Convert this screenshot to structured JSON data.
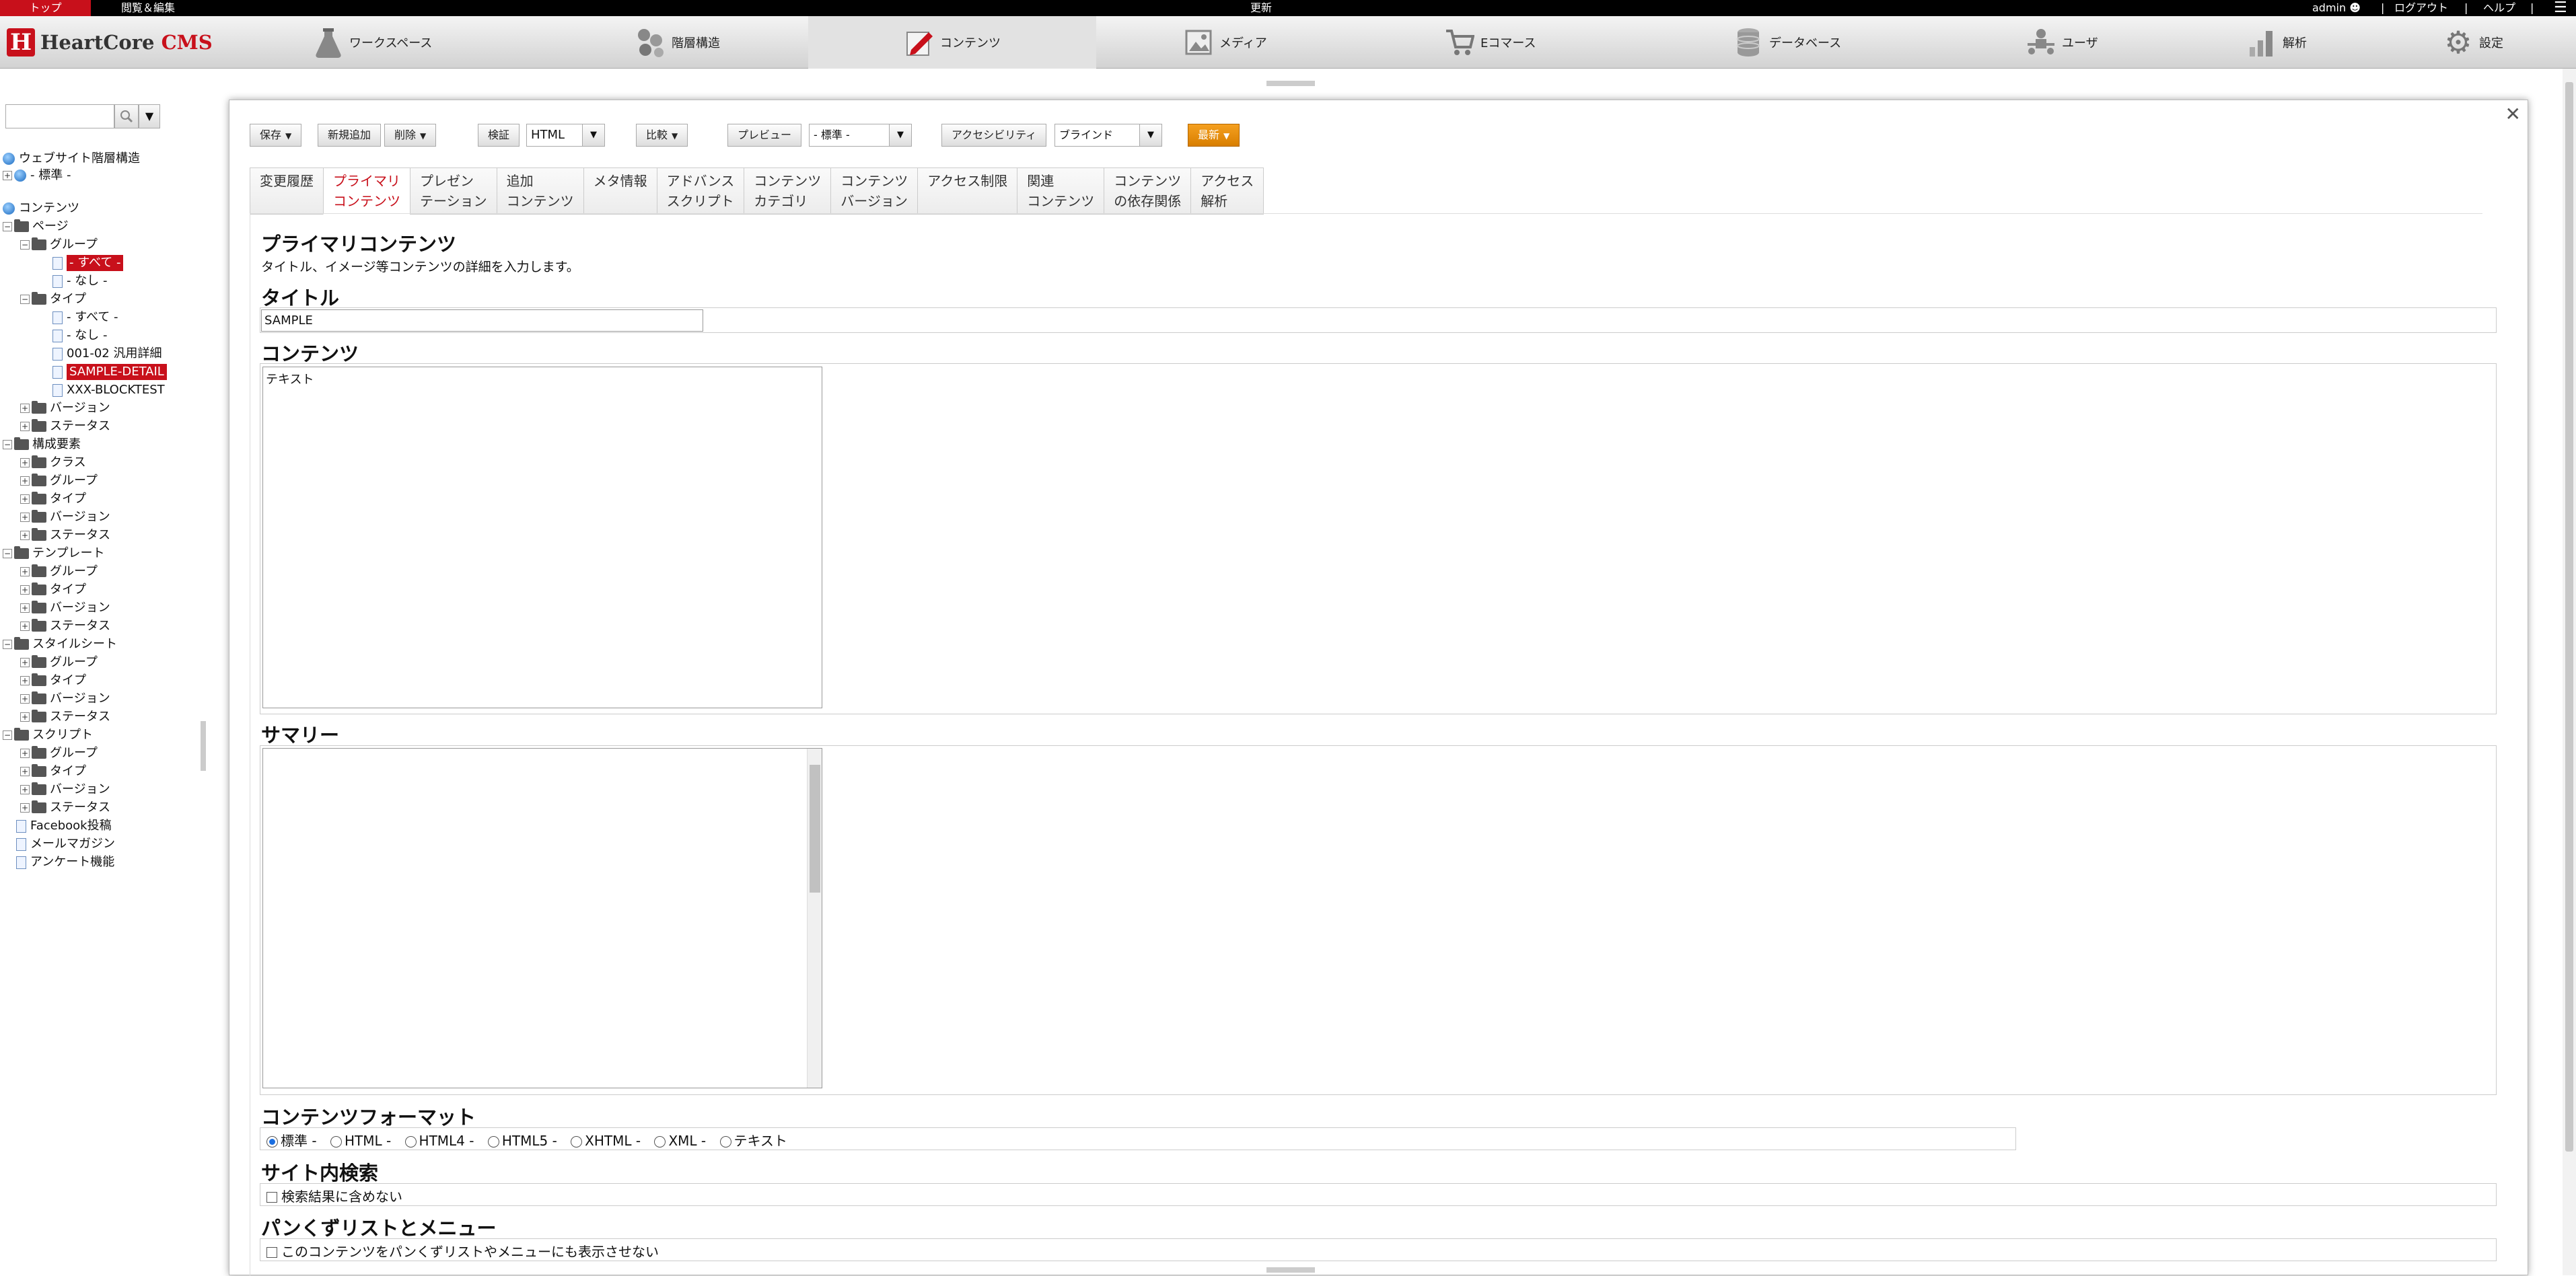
{
  "topbar": {
    "top": "トップ",
    "view_edit": "閲覧＆編集",
    "update": "更新",
    "admin": "admin",
    "logout": "ログアウト",
    "help": "ヘルプ",
    "separator": "|"
  },
  "brand": {
    "mark": "H",
    "name_part1": "Heart",
    "name_part2": "Core",
    "name_part3": " CMS",
    "accent_color": "#c8101b"
  },
  "nav": [
    {
      "label": "ワークスペース",
      "icon": "flask-icon"
    },
    {
      "label": "階層構造",
      "icon": "hierarchy-icon"
    },
    {
      "label": "コンテンツ",
      "icon": "content-edit-icon",
      "active": true
    },
    {
      "label": "メディア",
      "icon": "media-icon"
    },
    {
      "label": "Eコマース",
      "icon": "cart-icon"
    },
    {
      "label": "データベース",
      "icon": "database-icon"
    },
    {
      "label": "ユーザ",
      "icon": "users-icon"
    },
    {
      "label": "解析",
      "icon": "bar-chart-icon"
    },
    {
      "label": "設定",
      "icon": "gear-icon"
    }
  ],
  "tree": {
    "website": "ウェブサイト階層構造",
    "std": "- 標準 -",
    "contents": "コンテンツ",
    "page": "ページ",
    "group": "グループ",
    "all": "- すべて -",
    "none": "- なし -",
    "type": "タイプ",
    "t_all": "- すべて -",
    "t_none": "- なし -",
    "t_generic": "001-02 汎用詳細",
    "t_sample": "SAMPLE-DETAIL",
    "t_blocktest": "XXX-BLOCKTEST",
    "version": "バージョン",
    "status": "ステータス",
    "components": "構成要素",
    "c_class": "クラス",
    "c_group": "グループ",
    "c_type": "タイプ",
    "c_version": "バージョン",
    "c_status": "ステータス",
    "templates": "テンプレート",
    "tp_group": "グループ",
    "tp_type": "タイプ",
    "tp_version": "バージョン",
    "tp_status": "ステータス",
    "stylesheets": "スタイルシート",
    "ss_group": "グループ",
    "ss_type": "タイプ",
    "ss_version": "バージョン",
    "ss_status": "ステータス",
    "scripts": "スクリプト",
    "sc_group": "グループ",
    "sc_type": "タイプ",
    "sc_version": "バージョン",
    "sc_status": "ステータス",
    "facebook": "Facebook投稿",
    "mailmag": "メールマガジン",
    "survey": "アンケート機能"
  },
  "toolbar": {
    "save": "保存",
    "add_new": "新規追加",
    "delete": "削除",
    "validate": "検証",
    "validate_value": "HTML",
    "compare": "比較",
    "preview": "プレビュー",
    "preview_value": "- 標準 -",
    "accessibility": "アクセシビリティ",
    "accessibility_value": "ブラインド",
    "latest": "最新"
  },
  "tabs": [
    {
      "line1": "変更履歴",
      "line2": ""
    },
    {
      "line1": "プライマリ",
      "line2": "コンテンツ",
      "active": true
    },
    {
      "line1": "プレゼン",
      "line2": "テーション"
    },
    {
      "line1": "追加",
      "line2": "コンテンツ"
    },
    {
      "line1": "メタ情報",
      "line2": ""
    },
    {
      "line1": "アドバンス",
      "line2": "スクリプト"
    },
    {
      "line1": "コンテンツ",
      "line2": "カテゴリ"
    },
    {
      "line1": "コンテンツ",
      "line2": "バージョン"
    },
    {
      "line1": "アクセス制限",
      "line2": ""
    },
    {
      "line1": "関連",
      "line2": "コンテンツ"
    },
    {
      "line1": "コンテンツ",
      "line2": "の依存関係"
    },
    {
      "line1": "アクセス",
      "line2": "解析"
    }
  ],
  "form": {
    "section_title": "プライマリコンテンツ",
    "section_desc": "タイトル、イメージ等コンテンツの詳細を入力します。",
    "title_label": "タイトル",
    "title_value": "SAMPLE",
    "content_label": "コンテンツ",
    "content_value": "テキスト",
    "summary_label": "サマリー",
    "format_label": "コンテンツフォーマット",
    "formats": [
      "標準 -",
      "HTML -",
      "HTML4 -",
      "HTML5 -",
      "XHTML -",
      "XML -",
      "テキスト"
    ],
    "format_selected": "標準 -",
    "sitesearch_label": "サイト内検索",
    "sitesearch_option": "検索結果に含めない",
    "breadcrumb_label": "パンくずリストとメニュー",
    "breadcrumb_option": "このコンテンツをパンくずリストやメニューにも表示させない"
  }
}
